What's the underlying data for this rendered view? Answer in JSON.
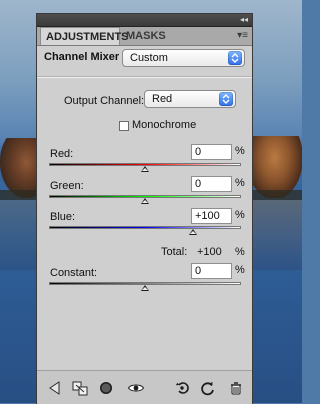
{
  "panel": {
    "tabs": [
      "ADJUSTMENTS",
      "MASKS"
    ],
    "preset": {
      "label": "Channel Mixer",
      "value": "Custom"
    },
    "output_channel": {
      "label": "Output Channel:",
      "value": "Red"
    },
    "monochrome": {
      "label": "Monochrome",
      "checked": false
    },
    "sliders": [
      {
        "label": "Red:",
        "value": "0",
        "unit": "%",
        "gradient": [
          "#000000",
          "#ff0000",
          "#ffffff"
        ],
        "thumb_fraction": 0.5
      },
      {
        "label": "Green:",
        "value": "0",
        "unit": "%",
        "gradient": [
          "#000000",
          "#00ff00",
          "#ffffff"
        ],
        "thumb_fraction": 0.5
      },
      {
        "label": "Blue:",
        "value": "+100",
        "unit": "%",
        "gradient": [
          "#000000",
          "#0000ff",
          "#ffffff"
        ],
        "thumb_fraction": 0.75
      }
    ],
    "total": {
      "label": "Total:",
      "value": "+100",
      "unit": "%"
    },
    "constant": {
      "label": "Constant:",
      "value": "0",
      "unit": "%",
      "gradient": [
        "#000000",
        "#7f7f7f",
        "#ffffff"
      ],
      "thumb_fraction": 0.5
    },
    "footer_icons": [
      "back-icon",
      "clip-to-layer-icon",
      "mask-icon",
      "visibility-eye-icon",
      "previous-state-icon",
      "reset-icon",
      "trash-icon"
    ],
    "colors": {
      "panel_bg": "#cfcfcf",
      "tabbar_bg": "#a9a9a9",
      "accent_blue": "#2f6ee6"
    }
  }
}
